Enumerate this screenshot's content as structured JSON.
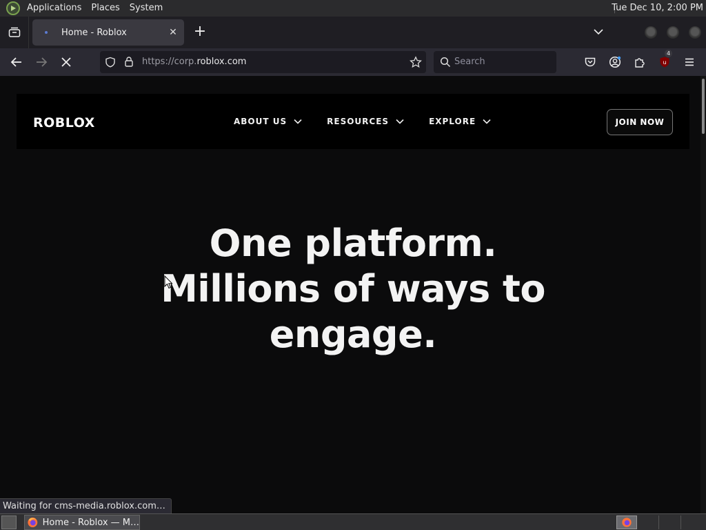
{
  "system": {
    "menus": [
      "Applications",
      "Places",
      "System"
    ],
    "clock": "Tue Dec 10,  2:00 PM"
  },
  "browser": {
    "tab_title": "Home - Roblox",
    "url_prefix": "https://corp.",
    "url_domain": "roblox.com",
    "search_placeholder": "Search",
    "extension_badge": "4",
    "status_text": "Waiting for cms-media.roblox.com…"
  },
  "site": {
    "logo": "ROBLOX",
    "nav": [
      {
        "label": "ABOUT US"
      },
      {
        "label": "RESOURCES"
      },
      {
        "label": "EXPLORE"
      }
    ],
    "cta": "JOIN NOW",
    "hero_lines": [
      "One platform.",
      "Millions of ways to",
      "engage."
    ]
  },
  "taskbar": {
    "task_title": "Home - Roblox — M…"
  }
}
